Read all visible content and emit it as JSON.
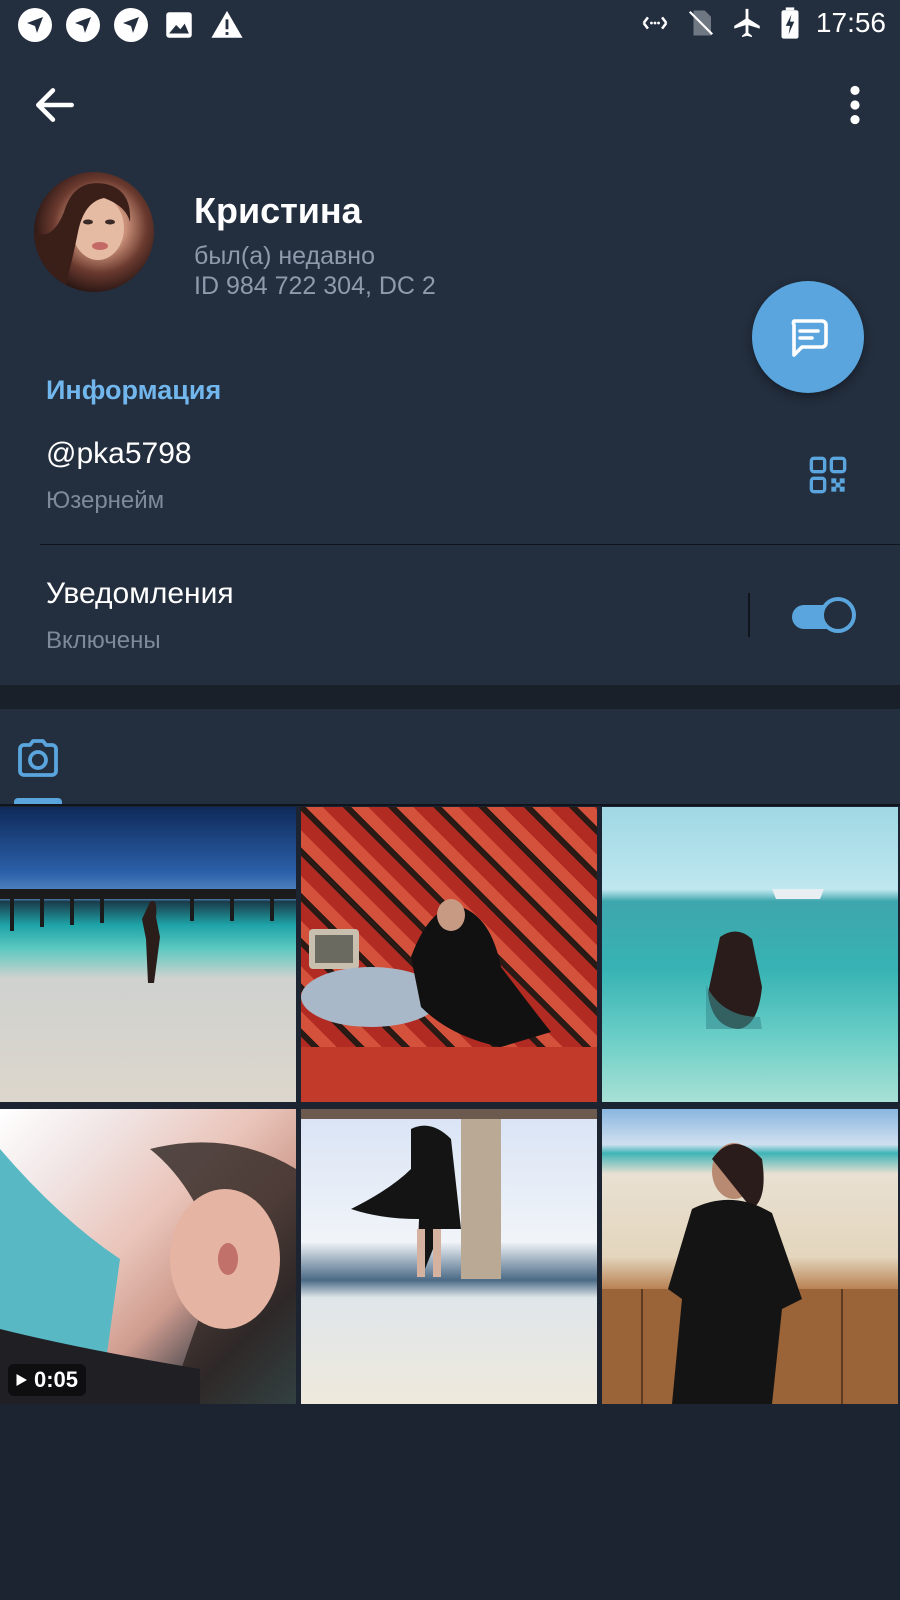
{
  "status_bar": {
    "time": "17:56",
    "left_icons": [
      "app-notification-icon",
      "app-notification-icon",
      "app-notification-icon",
      "image-icon",
      "warning-icon"
    ],
    "right_icons": [
      "data-saver-icon",
      "no-sim-icon",
      "airplane-mode-icon",
      "battery-charging-icon"
    ]
  },
  "header": {
    "back_icon": "arrow-back-icon",
    "menu_icon": "more-vertical-icon",
    "name": "Кристина",
    "last_seen": "был(а) недавно",
    "user_id": "ID 984 722 304, DC 2",
    "message_icon": "message-icon"
  },
  "info": {
    "section_title": "Информация",
    "username": "@pka5798",
    "username_caption": "Юзернейм",
    "qr_icon": "qr-code-icon",
    "notifications_title": "Уведомления",
    "notifications_caption": "Включены",
    "notifications_enabled": true
  },
  "media": {
    "active_tab_icon": "camera-icon",
    "items": [
      {
        "type": "photo"
      },
      {
        "type": "photo"
      },
      {
        "type": "photo"
      },
      {
        "type": "video",
        "duration": "0:05"
      },
      {
        "type": "photo"
      },
      {
        "type": "photo"
      }
    ]
  },
  "colors": {
    "background": "#1c2331",
    "panel": "#232e3e",
    "accent": "#5aa5dd",
    "section_title": "#71b6ec",
    "secondary_text": "#7d8b99"
  }
}
